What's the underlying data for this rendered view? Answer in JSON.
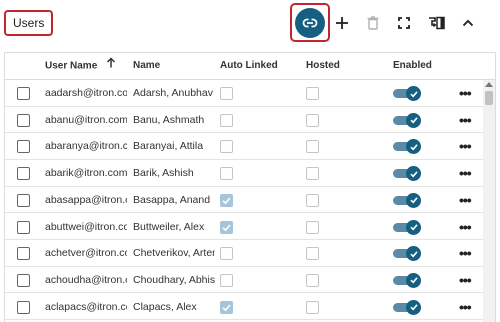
{
  "header": {
    "title": "Users"
  },
  "toolbar": {
    "buttons": [
      {
        "name": "link-button",
        "icon": "link-icon"
      },
      {
        "name": "add-button",
        "icon": "plus-icon"
      },
      {
        "name": "delete-button",
        "icon": "trash-icon"
      },
      {
        "name": "fullscreen-button",
        "icon": "expand-icon"
      },
      {
        "name": "manage-columns-button",
        "icon": "column-settings-icon"
      },
      {
        "name": "collapse-button",
        "icon": "chevron-up-icon"
      }
    ]
  },
  "table": {
    "columns": {
      "user_name": "User Name",
      "name": "Name",
      "auto_linked": "Auto Linked",
      "hosted": "Hosted",
      "enabled": "Enabled"
    },
    "sort": {
      "column": "User Name",
      "direction": "ascending",
      "icon": "arrow-up-icon"
    },
    "rows": [
      {
        "user": "aadarsh@itron.com",
        "name": "Adarsh, Anubhav",
        "auto_linked": false,
        "hosted": false,
        "enabled": true
      },
      {
        "user": "abanu@itron.com",
        "name": "Banu, Ashmath",
        "auto_linked": false,
        "hosted": false,
        "enabled": true
      },
      {
        "user": "abaranya@itron.com",
        "name": "Baranyai, Attila",
        "auto_linked": false,
        "hosted": false,
        "enabled": true
      },
      {
        "user": "abarik@itron.com",
        "name": "Barik, Ashish",
        "auto_linked": false,
        "hosted": false,
        "enabled": true
      },
      {
        "user": "abasappa@itron.com",
        "name": "Basappa, Anand",
        "auto_linked": true,
        "hosted": false,
        "enabled": true
      },
      {
        "user": "abuttwei@itron.com",
        "name": "Buttweiler, Alex",
        "auto_linked": true,
        "hosted": false,
        "enabled": true
      },
      {
        "user": "achetver@itron.com",
        "name": "Chetverikov, Artem",
        "auto_linked": false,
        "hosted": false,
        "enabled": true
      },
      {
        "user": "achoudha@itron.com",
        "name": "Choudhary, Abhishek",
        "auto_linked": false,
        "hosted": false,
        "enabled": true
      },
      {
        "user": "aclapacs@itron.com",
        "name": "Clapacs, Alex",
        "auto_linked": true,
        "hosted": false,
        "enabled": true
      }
    ],
    "row_menu_icon": "more-options-icon"
  },
  "colors": {
    "accent": "#155f82",
    "highlight_border": "#c2262e",
    "toggle_track": "#5b8aa6",
    "checked_disabled": "#a6c5da"
  }
}
